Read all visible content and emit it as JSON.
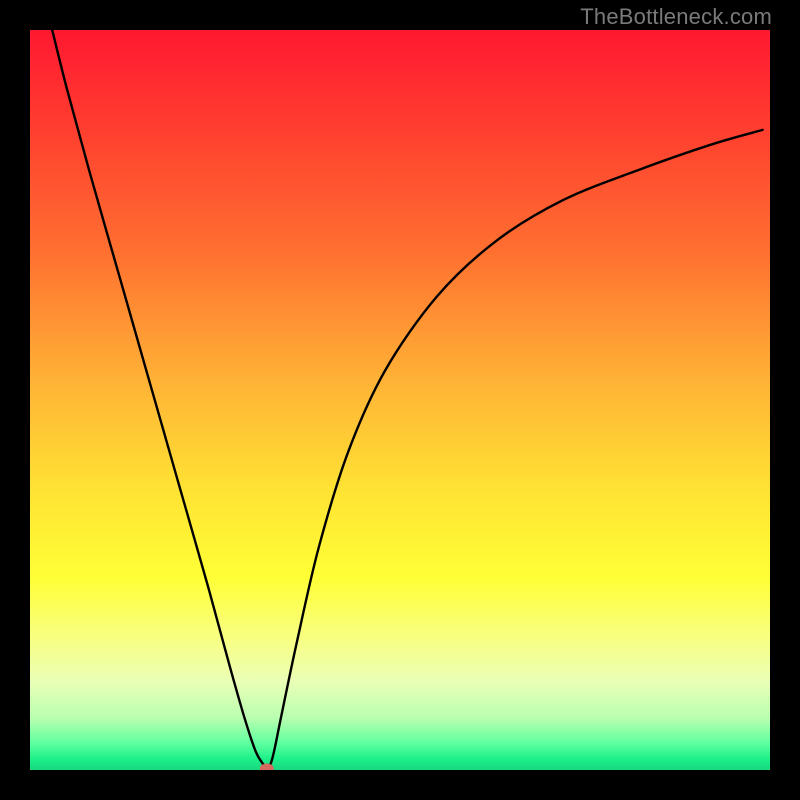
{
  "watermark": "TheBottleneck.com",
  "colors": {
    "frame_bg": "#000000",
    "curve_stroke": "#000000",
    "marker_fill": "#d46a5f",
    "gradient_stops": [
      {
        "offset": 0.0,
        "color": "#ff1830"
      },
      {
        "offset": 0.12,
        "color": "#ff3a2f"
      },
      {
        "offset": 0.3,
        "color": "#ff7030"
      },
      {
        "offset": 0.48,
        "color": "#ffb436"
      },
      {
        "offset": 0.62,
        "color": "#ffe233"
      },
      {
        "offset": 0.74,
        "color": "#ffff36"
      },
      {
        "offset": 0.82,
        "color": "#f8ff80"
      },
      {
        "offset": 0.88,
        "color": "#eaffb6"
      },
      {
        "offset": 0.93,
        "color": "#b9ffb0"
      },
      {
        "offset": 0.965,
        "color": "#5bff9e"
      },
      {
        "offset": 0.985,
        "color": "#1cf08a"
      },
      {
        "offset": 1.0,
        "color": "#17d97e"
      }
    ]
  },
  "chart_data": {
    "type": "line",
    "title": "",
    "xlabel": "",
    "ylabel": "",
    "xlim": [
      0,
      100
    ],
    "ylim": [
      0,
      100
    ],
    "grid": false,
    "legend": false,
    "series": [
      {
        "name": "bottleneck-curve",
        "x": [
          3,
          5,
          8,
          12,
          16,
          20,
          24,
          27,
          29,
          30.5,
          31.5,
          32,
          32.5,
          33,
          34,
          36,
          39,
          43,
          48,
          55,
          63,
          72,
          82,
          92,
          99
        ],
        "y": [
          100,
          92,
          81,
          67,
          53,
          39,
          25,
          14,
          7,
          2.5,
          0.8,
          0.2,
          0.8,
          2.6,
          7.5,
          17,
          30,
          43,
          54,
          64,
          71.5,
          77,
          81,
          84.5,
          86.5
        ]
      }
    ],
    "annotations": [
      {
        "name": "minimum-marker",
        "x": 32,
        "y": 0.2
      }
    ]
  }
}
